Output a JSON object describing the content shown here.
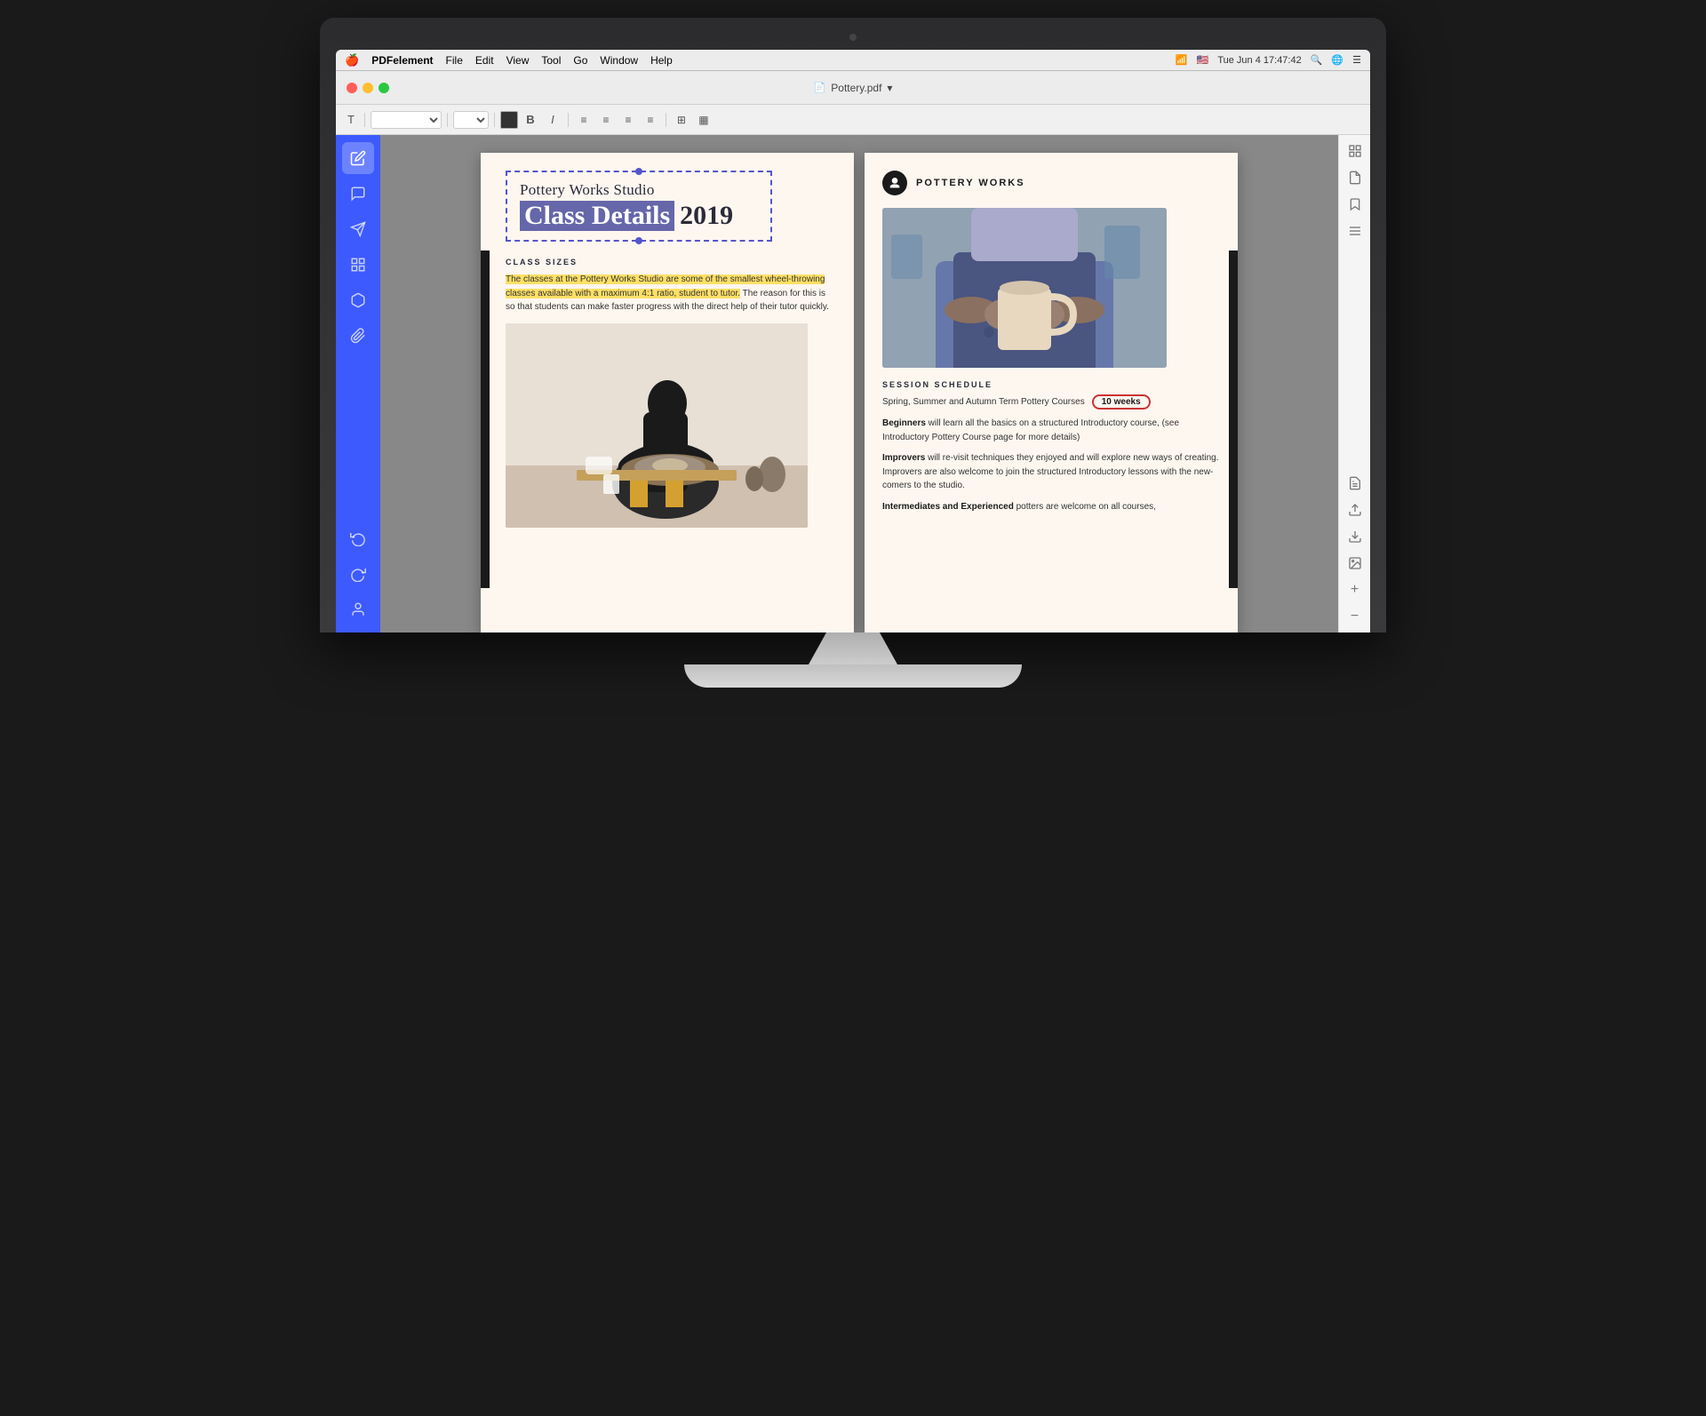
{
  "os": {
    "time": "Tue Jun 4  17:47:42"
  },
  "menubar": {
    "app_name": "PDFelement",
    "items": [
      "File",
      "Edit",
      "View",
      "Tool",
      "Go",
      "Window",
      "Help"
    ]
  },
  "titlebar": {
    "filename": "Pottery.pdf",
    "chevron": "▾"
  },
  "document": {
    "left_page": {
      "subtitle": "Pottery Works Studio",
      "title_bold": "Class Details",
      "title_year": "2019",
      "section_heading": "CLASS SIZES",
      "class_sizes_highlighted": "The classes at the Pottery Works Studio are some of the smallest wheel-throwing classes available with a maximum 4:1 ratio, student to tutor.",
      "class_sizes_normal": " The reason for this is so that students can make faster progress with the direct help of their tutor quickly."
    },
    "right_page": {
      "brand_name": "POTTERY WORKS",
      "session_schedule_title": "SESSION SCHEDULE",
      "session_intro": "Spring, Summer and Autumn Term Pottery Courses",
      "weeks_label": "10 weeks",
      "beginners_bold": "Beginners",
      "beginners_text": " will learn all the basics on a structured Introductory course, (see Introductory Pottery Course page for more details)",
      "improvers_bold": "Improvers",
      "improvers_text": " will re-visit techniques they enjoyed and will explore new ways of creating. Improvers are also welcome to join the structured Introductory lessons with the new-comers to the studio.",
      "intermediates_bold": "Intermediates and Experienced",
      "intermediates_text": " potters are welcome on all courses,"
    }
  },
  "sidebar": {
    "icons": [
      {
        "name": "edit-icon",
        "symbol": "✏️",
        "active": true
      },
      {
        "name": "comment-icon",
        "symbol": "💬",
        "active": false
      },
      {
        "name": "share-icon",
        "symbol": "➤",
        "active": false
      },
      {
        "name": "pages-icon",
        "symbol": "⊞",
        "active": false
      },
      {
        "name": "stamp-icon",
        "symbol": "⌘",
        "active": false
      },
      {
        "name": "attachment-icon",
        "symbol": "📎",
        "active": false
      }
    ],
    "bottom_icons": [
      {
        "name": "undo-icon",
        "symbol": "↩"
      },
      {
        "name": "redo-icon",
        "symbol": "↪"
      },
      {
        "name": "user-icon",
        "symbol": "👤"
      }
    ]
  },
  "right_panel": {
    "icons": [
      {
        "name": "grid-icon",
        "symbol": "⊞"
      },
      {
        "name": "page-icon",
        "symbol": "📄"
      },
      {
        "name": "bookmark-icon",
        "symbol": "🔖"
      },
      {
        "name": "menu-icon",
        "symbol": "☰"
      },
      {
        "name": "properties-icon",
        "symbol": "📋"
      },
      {
        "name": "export-icon",
        "symbol": "📤"
      },
      {
        "name": "import-icon",
        "symbol": "📥"
      },
      {
        "name": "image-icon",
        "symbol": "🖼"
      },
      {
        "name": "add-icon",
        "symbol": "+"
      },
      {
        "name": "minus-icon",
        "symbol": "−"
      }
    ]
  }
}
